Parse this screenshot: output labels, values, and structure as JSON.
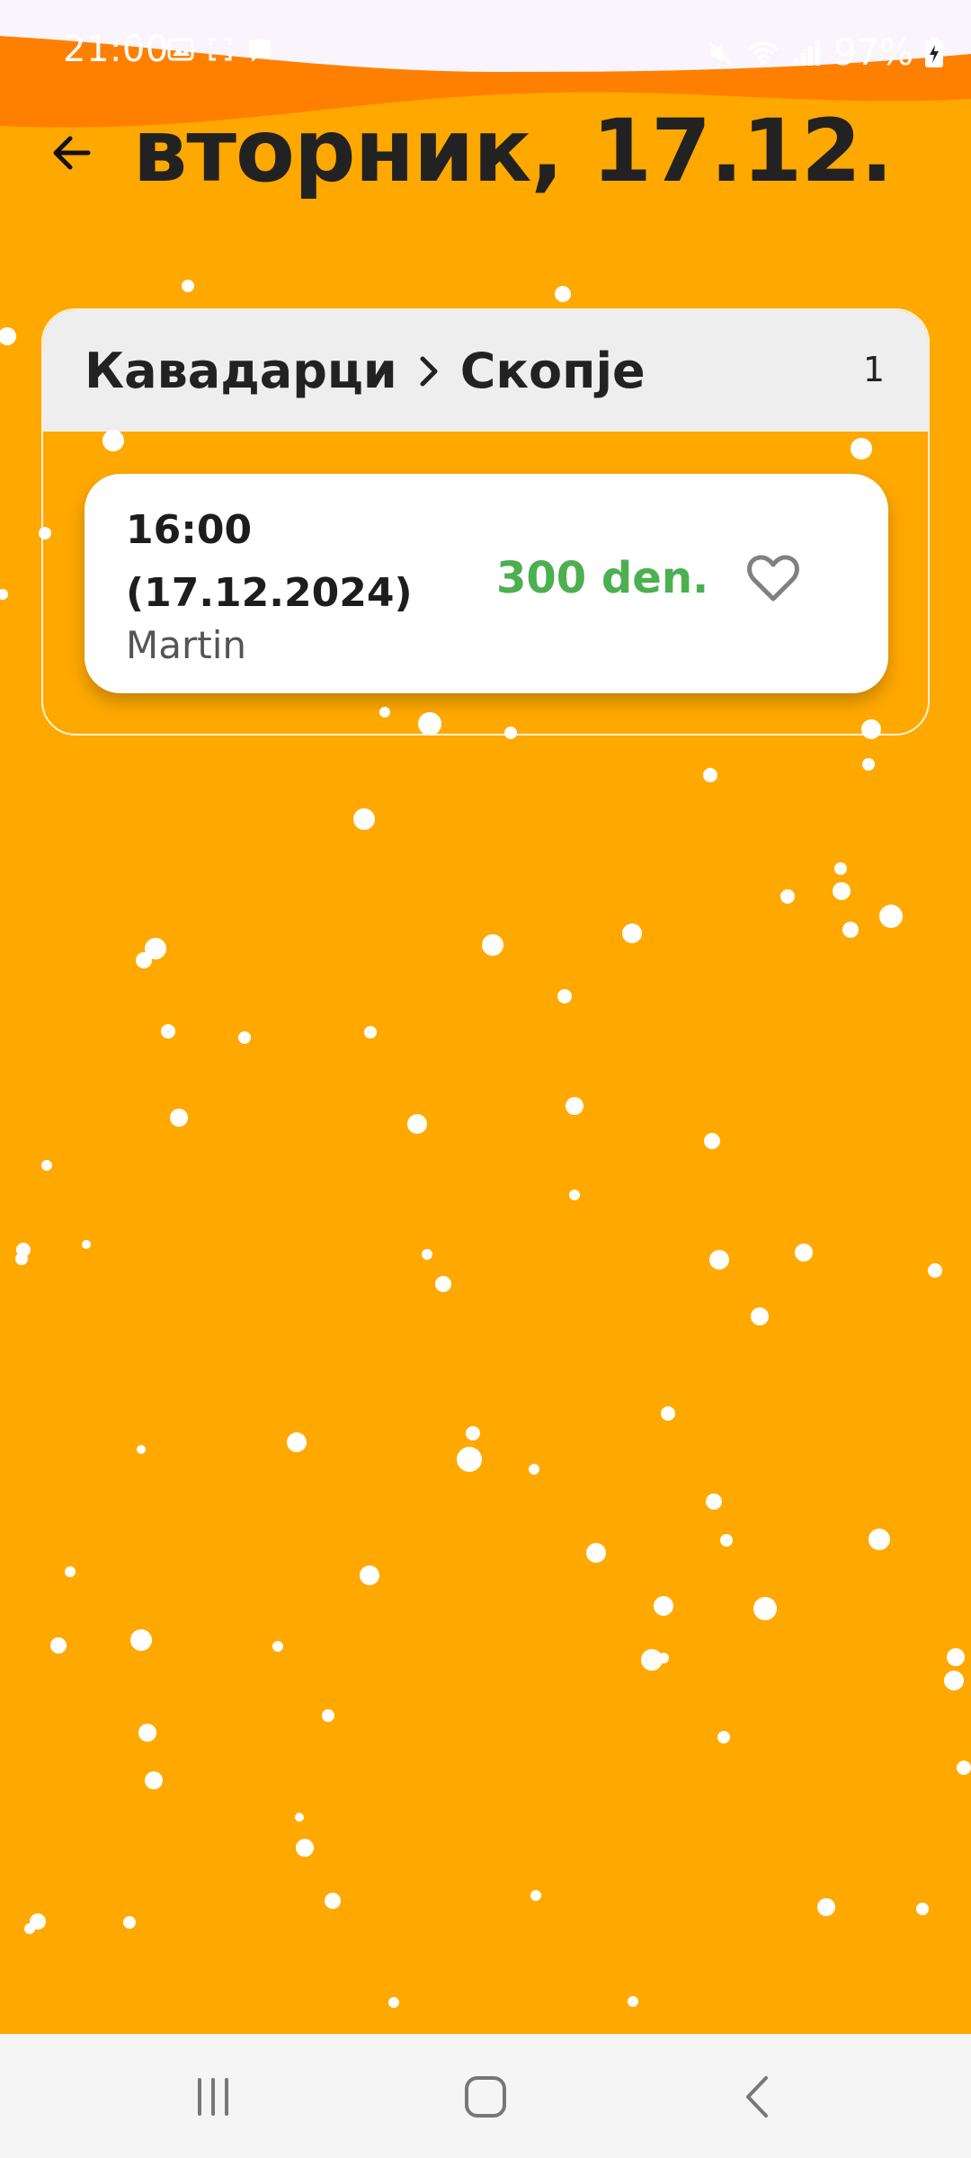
{
  "status_bar": {
    "time": "21:00",
    "battery_percent": "97%",
    "icons": [
      "gallery-icon",
      "screenshot-icon",
      "message-icon",
      "mute-icon",
      "wifi-icon",
      "signal-icon",
      "battery-charging-icon"
    ]
  },
  "header": {
    "title": "вторник, 17.12.",
    "back_icon": "arrow-left-icon"
  },
  "route": {
    "from": "Кавадарци",
    "to": "Скопје",
    "separator_icon": "chevron-right-icon",
    "count": "1",
    "rides": [
      {
        "time": "16:00",
        "date": "(17.12.2024)",
        "driver": "Martin",
        "price": "300 den.",
        "favorite_icon": "heart-outline-icon"
      }
    ]
  },
  "colors": {
    "background": "#FFA800",
    "header_band": "#FF7A00",
    "price": "#4CAF50",
    "card": "#FFFFFF",
    "route_header": "#EEEEEE"
  },
  "navbar": {
    "items": [
      "recent-apps-icon",
      "home-icon",
      "back-icon"
    ]
  }
}
